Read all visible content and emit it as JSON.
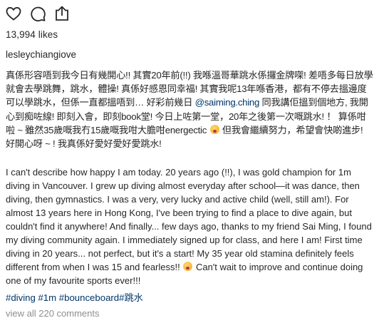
{
  "actions": {
    "like_icon": "heart-outline-icon",
    "comment_icon": "comment-bubble-icon",
    "share_icon": "share-upload-icon"
  },
  "likes": "13,994 likes",
  "username": "lesleychiangiove",
  "caption": {
    "zh_part1": "真係形容唔到我今日有幾開心!! 其實20年前(!!) 我喺溫哥華跳水係攞金牌㗎! 差唔多每日放學就會去學跳舞，跳水，體操! 真係好感恩同幸福! 其實我呢13年喺香港，都有不停去搵邊度可以學跳水，但係一直都搵唔到… 好彩前幾日 ",
    "zh_mention": "@saiming.ching",
    "zh_part2": " 同我講佢搵到個地方, 我開心到痴咗線! 即刻入會，即刻book堂! 今日上咗第一堂，20年之後第一次嘅跳水! ！ 算係咁啦 ~ 雖然35歲嘅我冇15歲嘅我咁大膽咁energectic ",
    "zh_part3": " 但我會繼續努力，希望會快啲進步! 好開心呀 ~ ! 我真係好愛好愛好愛跳水!",
    "en_part1": "I can't describe how happy I am today. 20 years ago (!!), I was gold champion for 1m diving in Vancouver. I grew up diving almost everyday after school—it was dance, then diving, then gymnastics. I was a very, very lucky and active child (well, still am!). For almost 13 years here in Hong Kong, I've been trying to find a place to dive again, but couldn't find it anywhere! And finally... few days ago, thanks to my friend Sai Ming, I found my diving community again. I immediately signed up for class, and here I am! First time diving in 20 years... not perfect, but it's a start! My 35 year old stamina definitely feels different from when I was 15 and fearless!! ",
    "en_part2": " Can't wait to improve and continue doing one of my favourite sports ever!!!",
    "emoji_icon": "crazy-face-emoji-icon"
  },
  "hashtags": [
    "#diving",
    "#1m",
    "#bounceboard",
    "#跳水"
  ],
  "view_comments": "view all 220 comments"
}
